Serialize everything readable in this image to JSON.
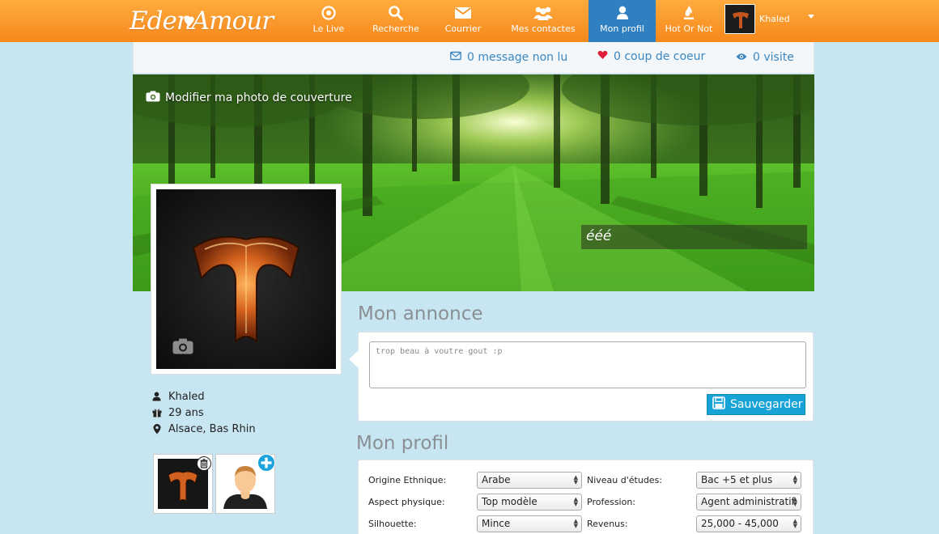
{
  "brand": {
    "logo_text": "EdenAmour",
    "primary_color": "#f7881c",
    "active_color": "#2f7fc1"
  },
  "nav": {
    "items": [
      {
        "label": "Le Live",
        "icon": "target-icon"
      },
      {
        "label": "Recherche",
        "icon": "search-icon"
      },
      {
        "label": "Courrier",
        "icon": "envelope-icon"
      },
      {
        "label": "Mes contactes",
        "icon": "users-icon"
      },
      {
        "label": "Mon profil",
        "icon": "user-icon",
        "active": true
      },
      {
        "label": "Hot Or Not",
        "icon": "flame-icon"
      }
    ],
    "user": {
      "name": "Khaled"
    }
  },
  "stats": {
    "messages": "0 message non lu",
    "likes": "0 coup de coeur",
    "visits": "0 visite"
  },
  "cover": {
    "edit_label": "Modifier ma photo de couverture",
    "tagline": "ééé"
  },
  "user": {
    "name": "Khaled",
    "age": "29 ans",
    "location": "Alsace, Bas Rhin"
  },
  "annonce": {
    "title": "Mon annonce",
    "text": "trop beau à voutre gout :p",
    "save_label": "Sauvegarder"
  },
  "profil": {
    "title": "Mon profil",
    "fields": [
      {
        "label": "Origine Ethnique:",
        "value": "Arabe"
      },
      {
        "label": "Niveau d'études:",
        "value": "Bac +5 et plus"
      },
      {
        "label": "Aspect physique:",
        "value": "Top modèle"
      },
      {
        "label": "Profession:",
        "value": "Agent administratif"
      },
      {
        "label": "Silhouette:",
        "value": "Mince"
      },
      {
        "label": "Revenus:",
        "value": "25,000 - 45,000"
      }
    ]
  }
}
